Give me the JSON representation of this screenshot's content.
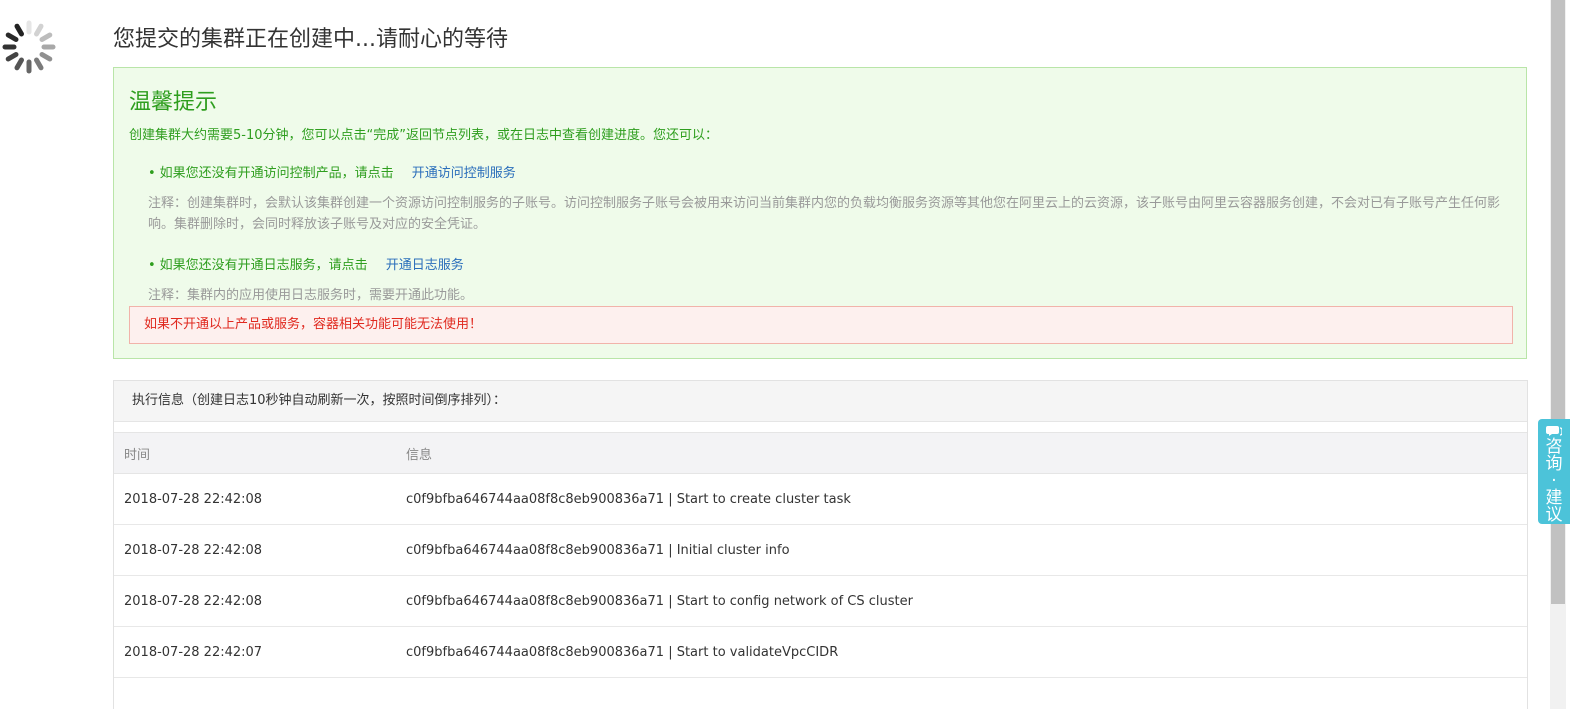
{
  "page": {
    "title": "您提交的集群正在创建中...请耐心的等待"
  },
  "tips": {
    "title": "温馨提示",
    "description": "创建集群大约需要5-10分钟，您可以点击“完成”返回节点列表，或在日志中查看创建进度。您还可以：",
    "items": [
      {
        "text": "如果您还没有开通访问控制产品，请点击",
        "link": "开通访问控制服务",
        "note": "注释：创建集群时，会默认该集群创建一个资源访问控制服务的子账号。访问控制服务子账号会被用来访问当前集群内您的负载均衡服务资源等其他您在阿里云上的云资源，该子账号由阿里云容器服务创建，不会对已有子账号产生任何影响。集群删除时，会同时释放该子账号及对应的安全凭证。"
      },
      {
        "text": "如果您还没有开通日志服务，请点击",
        "link": "开通日志服务",
        "note": "注释：集群内的应用使用日志服务时，需要开通此功能。"
      }
    ],
    "warning": "如果不开通以上产品或服务，容器相关功能可能无法使用！"
  },
  "exec": {
    "header": "执行信息（创建日志10秒钟自动刷新一次，按照时间倒序排列）：",
    "columns": {
      "time": "时间",
      "info": "信息"
    },
    "rows": [
      {
        "time": "2018-07-28 22:42:08",
        "info": "c0f9bfba646744aa08f8c8eb900836a71 | Start to create cluster task"
      },
      {
        "time": "2018-07-28 22:42:08",
        "info": "c0f9bfba646744aa08f8c8eb900836a71 | Initial cluster info"
      },
      {
        "time": "2018-07-28 22:42:08",
        "info": "c0f9bfba646744aa08f8c8eb900836a71 | Start to config network of CS cluster"
      },
      {
        "time": "2018-07-28 22:42:07",
        "info": "c0f9bfba646744aa08f8c8eb900836a71 | Start to validateVpcCIDR"
      }
    ]
  },
  "feedback": {
    "label": "咨询·建议",
    "icon": "chat-icon"
  },
  "colors": {
    "tips_green": "#2e9e1e",
    "link_blue": "#2a6ebb",
    "warning_red": "#e0281e",
    "feedback_cyan": "#4cc3d9"
  },
  "icons": {
    "loading": "loading-spinner-icon"
  }
}
